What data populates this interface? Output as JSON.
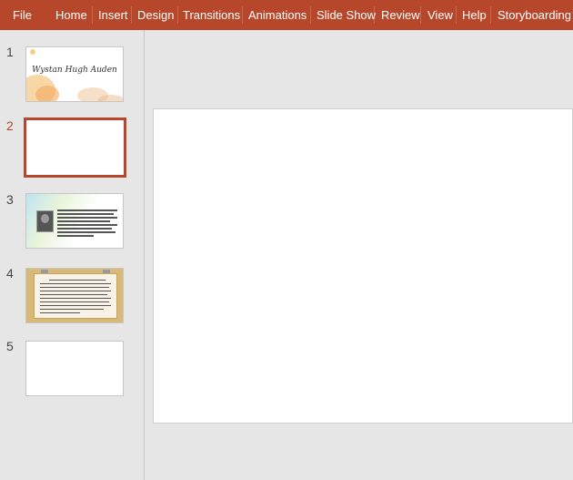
{
  "ribbon": {
    "color": "#b7472a",
    "tabs": [
      "File",
      "Home",
      "Insert",
      "Design",
      "Transitions",
      "Animations",
      "Slide Show",
      "Review",
      "View",
      "Help",
      "Storyboarding"
    ]
  },
  "slides": [
    {
      "number": "1",
      "title": "Wystan Hugh Auden"
    },
    {
      "number": "2",
      "active": true
    },
    {
      "number": "3"
    },
    {
      "number": "4"
    },
    {
      "number": "5"
    }
  ]
}
